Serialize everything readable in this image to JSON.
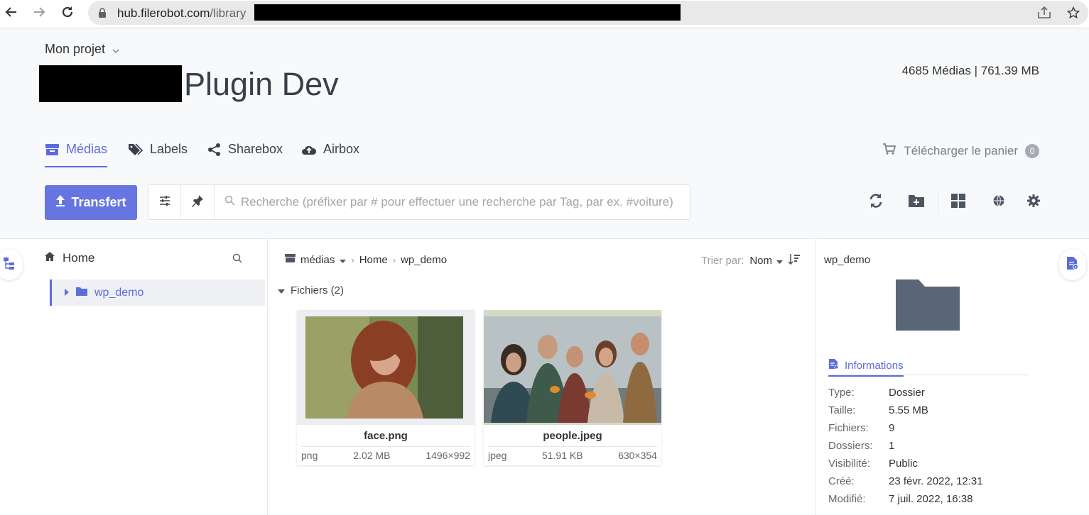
{
  "browser": {
    "url_host": "hub.filerobot.com",
    "url_path": "/library"
  },
  "header": {
    "project_label": "Mon projet",
    "title": "Plugin Dev",
    "stats": "4685 Médias | 761.39 MB"
  },
  "tabs": [
    {
      "label": "Médias",
      "icon": "archive-box-icon",
      "active": true
    },
    {
      "label": "Labels",
      "icon": "tags-icon",
      "active": false
    },
    {
      "label": "Sharebox",
      "icon": "share-icon",
      "active": false
    },
    {
      "label": "Airbox",
      "icon": "cloud-upload-icon",
      "active": false
    }
  ],
  "cart": {
    "label": "Télécharger le panier",
    "count": "0"
  },
  "toolbar": {
    "upload_label": "Transfert",
    "search_placeholder": "Recherche (préfixer par # pour effectuer une recherche par Tag, par ex. #voiture)"
  },
  "tree": {
    "home_label": "Home",
    "items": [
      {
        "label": "wp_demo",
        "selected": true
      }
    ]
  },
  "content": {
    "breadcrumb": [
      "médias",
      "Home",
      "wp_demo"
    ],
    "sort_label": "Trier par:",
    "sort_value": "Nom",
    "group_label": "Fichiers (2)",
    "files": [
      {
        "name": "face.png",
        "type": "png",
        "size": "2.02 MB",
        "dimensions": "1496×992"
      },
      {
        "name": "people.jpeg",
        "type": "jpeg",
        "size": "51.91 KB",
        "dimensions": "630×354"
      }
    ]
  },
  "details": {
    "folder_name": "wp_demo",
    "tab_label": "Informations",
    "rows": [
      {
        "key": "Type:",
        "value": "Dossier"
      },
      {
        "key": "Taille:",
        "value": "5.55 MB"
      },
      {
        "key": "Fichiers:",
        "value": "9"
      },
      {
        "key": "Dossiers:",
        "value": "1"
      },
      {
        "key": "Visibilité:",
        "value": "Public"
      },
      {
        "key": "Créé:",
        "value": "23 févr. 2022, 12:31"
      },
      {
        "key": "Modifié:",
        "value": "7 juil. 2022, 16:38"
      }
    ]
  },
  "colors": {
    "accent": "#5c6bdd",
    "upload_button": "#6675e0",
    "folder": "#5a6675"
  }
}
